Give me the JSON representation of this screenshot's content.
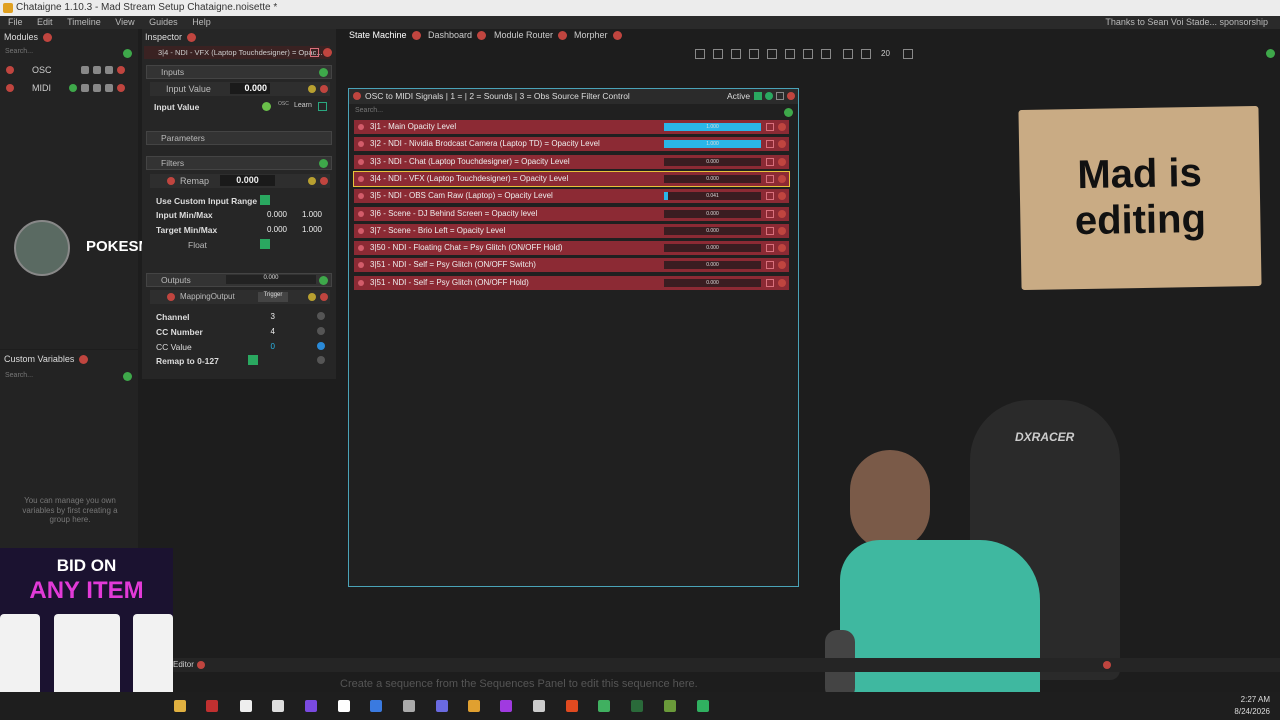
{
  "window": {
    "title": "Chataigne 1.10.3 - Mad Stream Setup Chataigne.noisette *",
    "thanks": "Thanks to Sean Voi Stade... sponsorship"
  },
  "menu": [
    "File",
    "Edit",
    "Timeline",
    "View",
    "Guides",
    "Help"
  ],
  "modules": {
    "title": "Modules",
    "search": "Search...",
    "items": [
      {
        "label": "OSC"
      },
      {
        "label": "MIDI"
      }
    ]
  },
  "custom_variables": {
    "title": "Custom Variables",
    "search": "Search...",
    "empty": "You can manage you own variables by first creating a group here."
  },
  "inspector": {
    "title": "Inspector",
    "item": "3|4 - NDI - VFX (Laptop Touchdesigner) = Opac...",
    "inputs": {
      "label": "Inputs",
      "input_value_label": "Input Value",
      "input_value": "0.000",
      "row_label": "Input Value",
      "learn": "Learn",
      "osc": "OSC"
    },
    "parameters": "Parameters",
    "filters": {
      "label": "Filters",
      "remap_label": "Remap",
      "remap_value": "0.000",
      "use_custom": "Use Custom Input Range",
      "input_minmax": "Input Min/Max",
      "in_min": "0.000",
      "in_max": "1.000",
      "target_minmax": "Target Min/Max",
      "t_min": "0.000",
      "t_max": "1.000",
      "float": "Float"
    },
    "outputs": {
      "label": "Outputs",
      "value": "0.000",
      "mapping": "MappingOutput",
      "trigger": "Trigger",
      "channel_label": "Channel",
      "channel": "3",
      "cc_number_label": "CC Number",
      "cc_number": "4",
      "cc_value_label": "CC Value",
      "cc_value": "0",
      "remap_label": "Remap to 0-127"
    }
  },
  "tabs": [
    {
      "label": "State Machine"
    },
    {
      "label": "Dashboard"
    },
    {
      "label": "Module Router"
    },
    {
      "label": "Morpher"
    }
  ],
  "zoom": "20",
  "state_machine": {
    "title": "OSC to MIDI Signals | 1 = | 2 = Sounds | 3 = Obs Source Filter Control",
    "status": "Active",
    "search": "Search...",
    "rows": [
      {
        "label": "3|1 - Main Opacity Level",
        "value": "1.000",
        "level": 1.0,
        "sel": false
      },
      {
        "label": "3|2 - NDI - Nividia Brodcast Camera (Laptop TD) = Opacity Level",
        "value": "1.000",
        "level": 1.0,
        "sel": false
      },
      {
        "label": "3|3 - NDI - Chat (Laptop Touchdesigner) = Opacity Level",
        "value": "0.000",
        "level": 0.0,
        "sel": false
      },
      {
        "label": "3|4 - NDI - VFX (Laptop Touchdesigner) = Opacity Level",
        "value": "0.000",
        "level": 0.0,
        "sel": true
      },
      {
        "label": "3|5 - NDI - OBS Cam Raw (Laptop) = Opacity Level",
        "value": "0.041",
        "level": 0.041,
        "sel": false
      },
      {
        "label": "3|6 - Scene - DJ Behind Screen = Opacity level",
        "value": "0.000",
        "level": 0.0,
        "sel": false
      },
      {
        "label": "3|7 - Scene - Brio Left = Opacity Level",
        "value": "0.000",
        "level": 0.0,
        "sel": false
      },
      {
        "label": "3|50 - NDI - Floating Chat = Psy Glitch (ON/OFF Hold)",
        "value": "0.000",
        "level": 0.0,
        "sel": false
      },
      {
        "label": "3|51 - NDI - Self = Psy Glitch (ON/OFF Switch)",
        "value": "0.000",
        "level": 0.0,
        "sel": false
      },
      {
        "label": "3|51 - NDI - Self = Psy Glitch (ON/OFF Hold)",
        "value": "0.000",
        "level": 0.0,
        "sel": false
      }
    ]
  },
  "overlay": {
    "sign_line1": "Mad is",
    "sign_line2": "editing",
    "username": "POKESMOT",
    "bid_line1": "BID ON",
    "bid_line2": "ANY ITEM",
    "chair_brand": "DXRACER"
  },
  "bottom": {
    "editor_label": "Editor",
    "hint": "Create a sequence from the Sequences Panel to edit this sequence here."
  },
  "clock": {
    "time": "2:27 AM",
    "date": "8/24/2026"
  }
}
